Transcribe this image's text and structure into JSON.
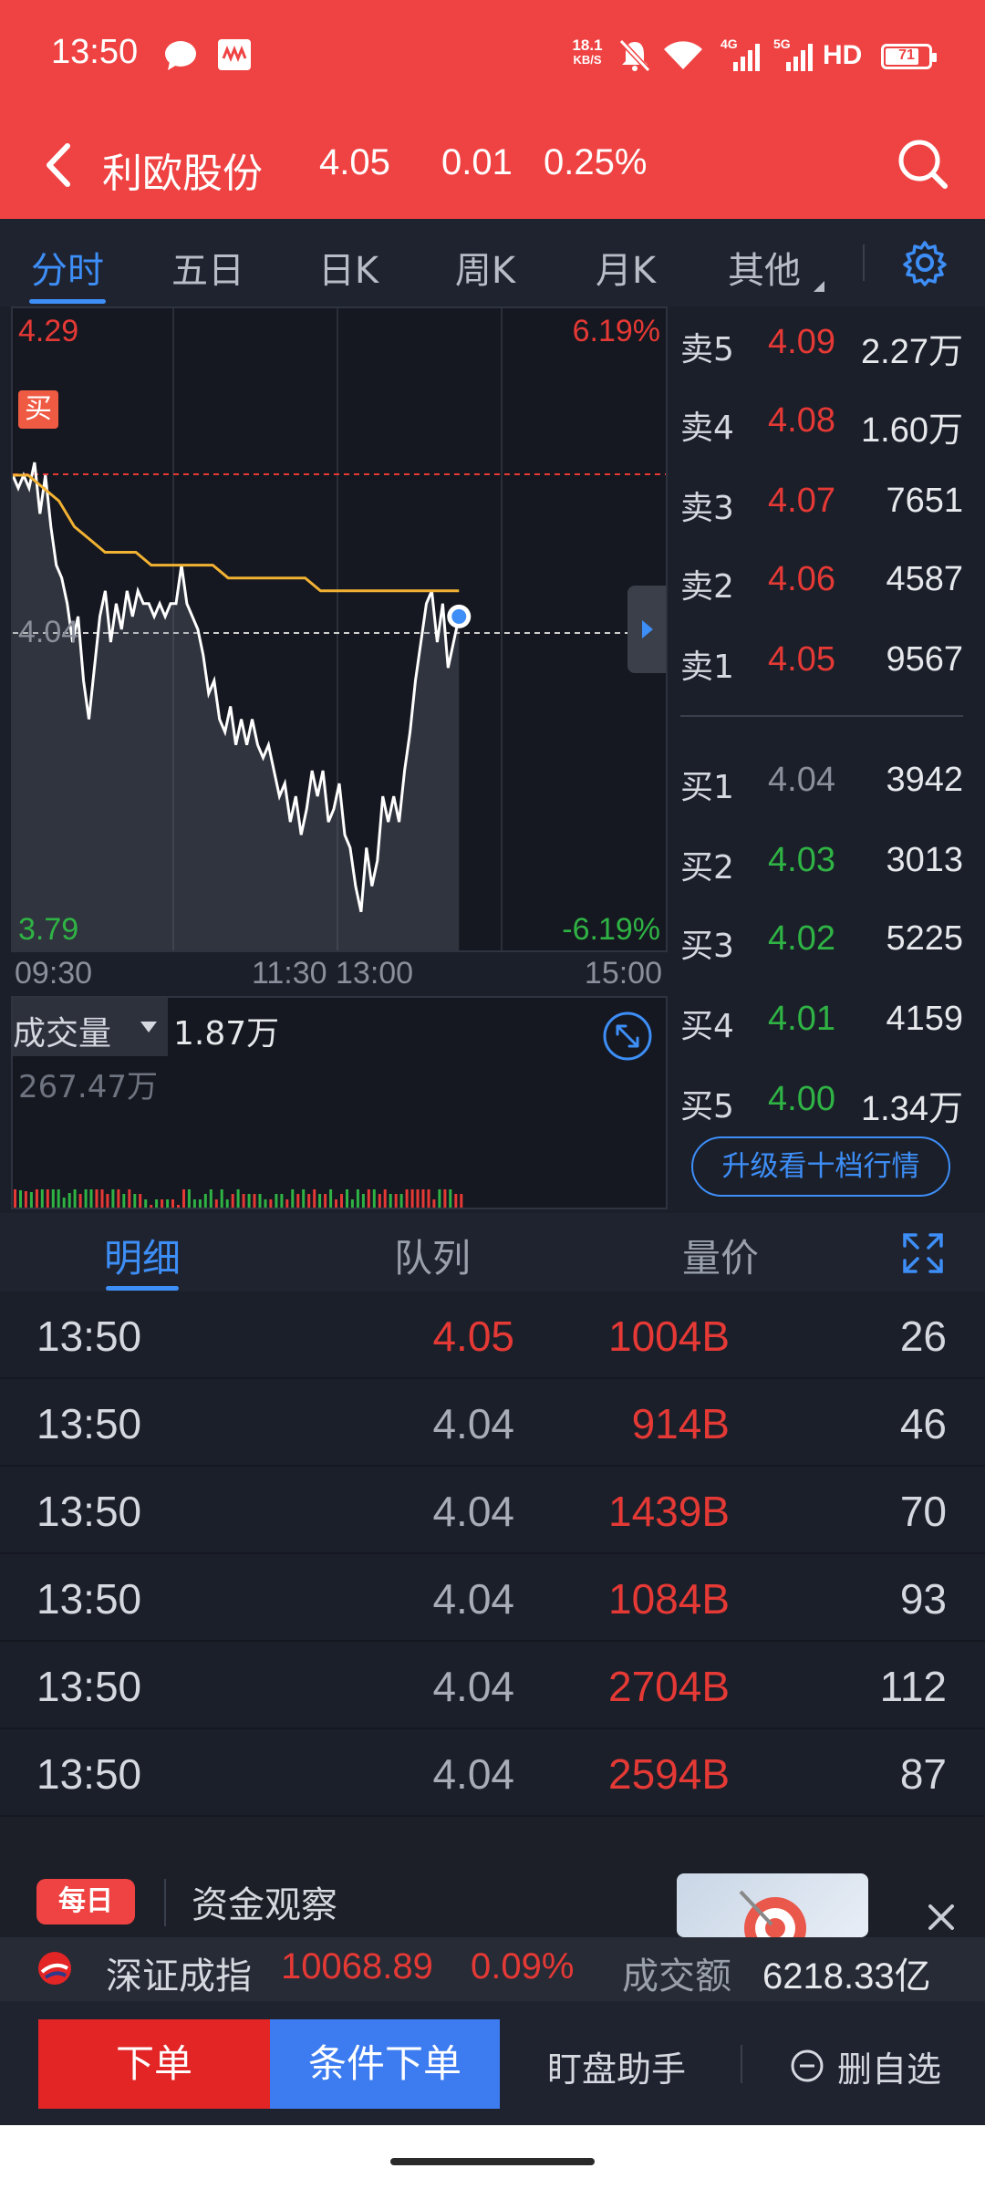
{
  "status_bar": {
    "time": "13:50",
    "net_speed_top": "18.1",
    "net_speed_unit": "KB/S",
    "sim1": "4G",
    "sim2": "5G",
    "hd": "HD",
    "battery": "71"
  },
  "header": {
    "stock_name": "利欧股份",
    "price": "4.05",
    "change": "0.01",
    "change_pct": "0.25%"
  },
  "tabs": [
    "分时",
    "五日",
    "日K",
    "周K",
    "月K",
    "其他"
  ],
  "chart": {
    "price_high": "4.29",
    "price_mid": "4.04",
    "price_low": "3.79",
    "pct_high": "6.19%",
    "pct_low": "-6.19%",
    "buy_marker": "买",
    "time_labels": [
      "09:30",
      "11:30 13:00",
      "15:00"
    ],
    "colors": {
      "up": "#e53935",
      "down": "#2fb344",
      "avg_line": "#f2b233",
      "price_line": "#ffffff"
    }
  },
  "chart_data": {
    "type": "line",
    "title": "",
    "xlabel": "",
    "ylabel": "",
    "ylim": [
      3.79,
      4.29
    ],
    "series": [
      {
        "values": [
          4.16,
          4.15,
          4.16,
          4.15,
          4.17,
          4.13,
          4.16,
          4.12,
          4.09,
          4.08,
          4.06,
          4.03,
          4.05,
          4.0,
          3.97,
          4.01,
          4.05,
          4.07,
          4.03,
          4.06,
          4.04,
          4.07,
          4.05,
          4.07,
          4.06,
          4.06,
          4.05,
          4.06,
          4.05,
          4.06,
          4.06,
          4.09,
          4.06,
          4.05,
          4.04,
          4.02,
          3.99,
          4.0,
          3.97,
          3.96,
          3.98,
          3.95,
          3.97,
          3.95,
          3.97,
          3.95,
          3.94,
          3.95,
          3.93,
          3.91,
          3.92,
          3.89,
          3.91,
          3.88,
          3.9,
          3.93,
          3.91,
          3.93,
          3.89,
          3.9,
          3.92,
          3.88,
          3.87,
          3.84,
          3.82,
          3.87,
          3.84,
          3.86,
          3.91,
          3.89,
          3.91,
          3.89,
          3.93,
          3.96,
          4.0,
          4.03,
          4.06,
          4.07,
          4.03,
          4.06,
          4.01,
          4.03,
          4.05
        ]
      },
      {
        "values": [
          4.16,
          4.16,
          4.15,
          4.14,
          4.12,
          4.11,
          4.1,
          4.1,
          4.1,
          4.09,
          4.09,
          4.09,
          4.09,
          4.09,
          4.08,
          4.08,
          4.08,
          4.08,
          4.08,
          4.08,
          4.07,
          4.07,
          4.07,
          4.07,
          4.07,
          4.07,
          4.07,
          4.07,
          4.07,
          4.07
        ]
      }
    ]
  },
  "volume": {
    "label": "成交量",
    "current": "1.87万",
    "max": "267.47万"
  },
  "order_book": {
    "asks": [
      {
        "label": "卖5",
        "price": "4.09",
        "vol": "2.27万"
      },
      {
        "label": "卖4",
        "price": "4.08",
        "vol": "1.60万"
      },
      {
        "label": "卖3",
        "price": "4.07",
        "vol": "7651"
      },
      {
        "label": "卖2",
        "price": "4.06",
        "vol": "4587"
      },
      {
        "label": "卖1",
        "price": "4.05",
        "vol": "9567"
      }
    ],
    "bids": [
      {
        "label": "买1",
        "price": "4.04",
        "vol": "3942"
      },
      {
        "label": "买2",
        "price": "4.03",
        "vol": "3013"
      },
      {
        "label": "买3",
        "price": "4.02",
        "vol": "5225"
      },
      {
        "label": "买4",
        "price": "4.01",
        "vol": "4159"
      },
      {
        "label": "买5",
        "price": "4.00",
        "vol": "1.34万"
      }
    ],
    "upgrade_label": "升级看十档行情"
  },
  "detail_tabs": [
    "明细",
    "队列",
    "量价"
  ],
  "trades": [
    {
      "time": "13:50",
      "price": "4.05",
      "qty": "1004B",
      "count": "26"
    },
    {
      "time": "13:50",
      "price": "4.04",
      "qty": "914B",
      "count": "46"
    },
    {
      "time": "13:50",
      "price": "4.04",
      "qty": "1439B",
      "count": "70"
    },
    {
      "time": "13:50",
      "price": "4.04",
      "qty": "1084B",
      "count": "93"
    },
    {
      "time": "13:50",
      "price": "4.04",
      "qty": "2704B",
      "count": "112"
    },
    {
      "time": "13:50",
      "price": "4.04",
      "qty": "2594B",
      "count": "87"
    }
  ],
  "ad": {
    "badge": "每日",
    "title": "资金观察"
  },
  "index_bar": {
    "name": "深证成指",
    "value": "10068.89",
    "pct": "0.09%",
    "amount_label": "成交额",
    "amount": "6218.33亿"
  },
  "actions": {
    "order": "下单",
    "conditional_order": "条件下单",
    "watch_assistant": "盯盘助手",
    "remove_watch": "删自选"
  }
}
